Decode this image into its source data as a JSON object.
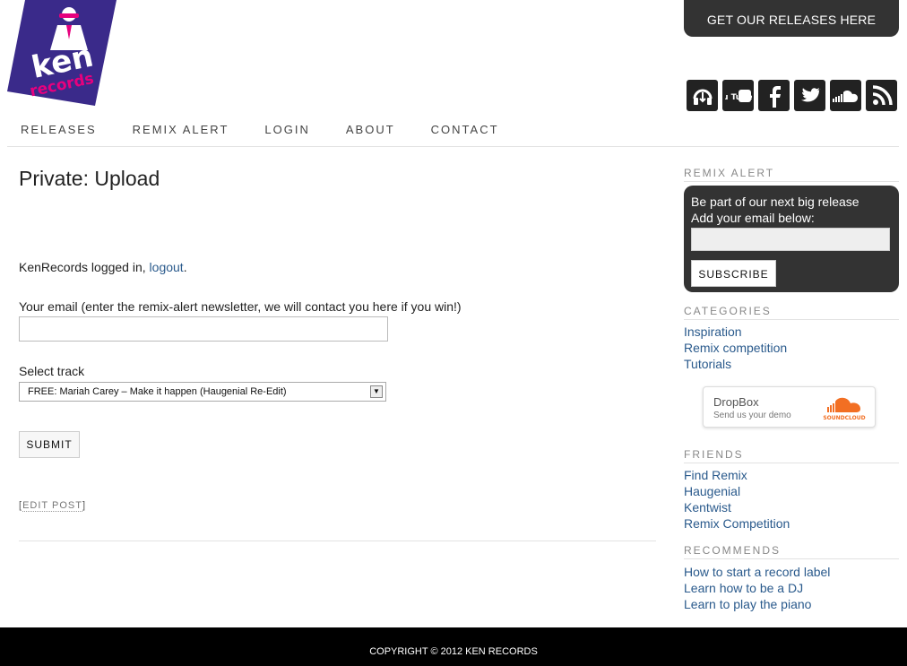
{
  "logo": {
    "text_top": "ken",
    "text_bottom": "records",
    "colors": {
      "purple": "#3a2a8a",
      "pink": "#e6007e"
    }
  },
  "header": {
    "releases_button": "GET OUR RELEASES HERE"
  },
  "social_icons": [
    "download-icon",
    "youtube-icon",
    "facebook-icon",
    "twitter-icon",
    "soundcloud-icon",
    "rss-icon"
  ],
  "social_youtube_text": "You Tube",
  "nav": [
    "RELEASES",
    "REMIX ALERT",
    "LOGIN",
    "ABOUT",
    "CONTACT"
  ],
  "main": {
    "title": "Private: Upload",
    "logged_in_prefix": "KenRecords logged in, ",
    "logout_link": "logout",
    "logged_in_suffix": ".",
    "email_label": "Your email (enter the remix-alert newsletter, we will contact you here if you win!)",
    "email_value": "",
    "track_label": "Select track",
    "track_selected": "FREE: Mariah Carey – Make it happen (Haugenial Re-Edit)",
    "submit_label": "SUBMIT",
    "edit_prefix": "[",
    "edit_post": "EDIT POST",
    "edit_suffix": "]"
  },
  "sidebar": {
    "remix_alert": {
      "heading": "REMIX ALERT",
      "line1": "Be part of our next big release",
      "line2": "Add your email below:",
      "subscribe_label": "SUBSCRIBE"
    },
    "categories": {
      "heading": "CATEGORIES",
      "items": [
        "Inspiration",
        "Remix competition",
        "Tutorials"
      ]
    },
    "dropbox": {
      "title": "DropBox",
      "subtitle": "Send us your demo",
      "brand": "SOUNDCLOUD"
    },
    "friends": {
      "heading": "FRIENDS",
      "items": [
        "Find Remix",
        "Haugenial",
        "Kentwist",
        "Remix Competition"
      ]
    },
    "recommends": {
      "heading": "RECOMMENDS",
      "items": [
        "How to start a record label",
        "Learn how to be a DJ",
        "Learn to play the piano"
      ]
    }
  },
  "footer": {
    "copyright": "COPYRIGHT © 2012 KEN RECORDS"
  },
  "colors": {
    "link": "#2a5a8c",
    "dark_box": "#333333",
    "footer_bg": "#000000",
    "soundcloud_orange": "#f26f23"
  }
}
